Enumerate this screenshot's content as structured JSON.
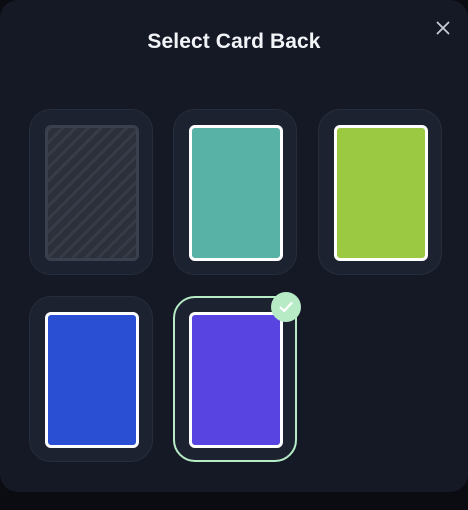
{
  "dialog": {
    "title": "Select Card Back"
  },
  "icons": {
    "close": "close-icon",
    "selected": "checkmark-icon"
  },
  "card_backs": [
    {
      "name": "pattern",
      "style": "striped",
      "color": "#2b303b",
      "selected": false
    },
    {
      "name": "teal",
      "style": "solid",
      "color": "#58b3a6",
      "selected": false
    },
    {
      "name": "lime",
      "style": "solid",
      "color": "#9cc942",
      "selected": false
    },
    {
      "name": "blue",
      "style": "solid",
      "color": "#2a4fd3",
      "selected": false
    },
    {
      "name": "purple",
      "style": "solid",
      "color": "#5744e1",
      "selected": true
    }
  ],
  "colors": {
    "background": "#141925",
    "tile": "#1c2230",
    "selected_accent": "#b7ebc6",
    "card_border": "#ffffff"
  }
}
